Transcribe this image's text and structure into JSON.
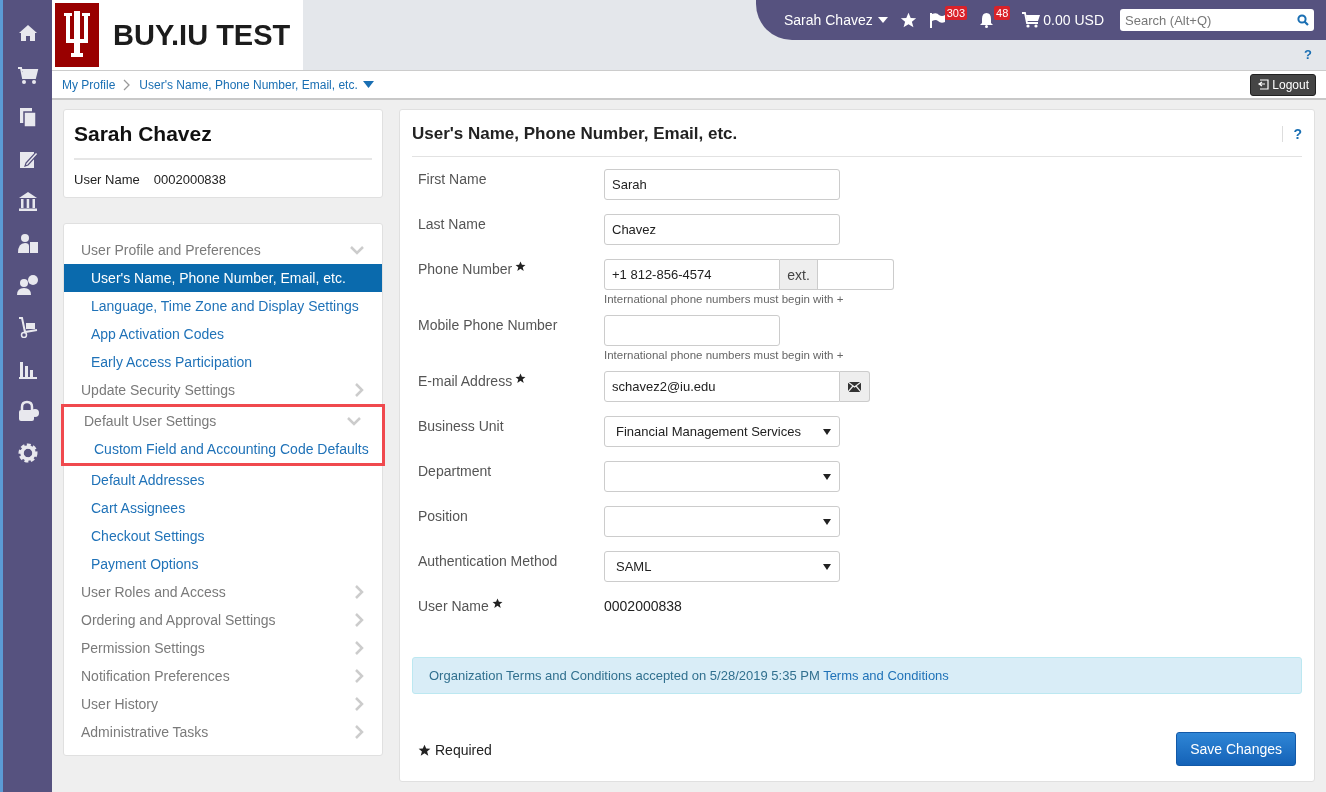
{
  "header": {
    "logo_text": "BUY.IU TEST",
    "user_menu": "Sarah Chavez",
    "flag_count": "303",
    "bell_count": "48",
    "cart_total": "0.00 USD",
    "search": {
      "placeholder": "Search (Alt+Q)"
    },
    "help": "?"
  },
  "breadcrumb": {
    "items": [
      {
        "label": "My Profile",
        "dropdown": false
      },
      {
        "label": "User's Name, Phone Number, Email, etc.",
        "dropdown": true
      }
    ],
    "logout": "Logout"
  },
  "profile": {
    "name": "Sarah Chavez",
    "user_name_label": "User Name",
    "user_name_value": "0002000838"
  },
  "nav": {
    "sections": [
      {
        "label": "User Profile and Preferences",
        "expanded": true,
        "highlighted": false,
        "children": [
          {
            "label": "User's Name, Phone Number, Email, etc.",
            "selected": true,
            "highlighted": false
          },
          {
            "label": "Language, Time Zone and Display Settings",
            "selected": false,
            "highlighted": false
          },
          {
            "label": "App Activation Codes",
            "selected": false,
            "highlighted": false
          },
          {
            "label": "Early Access Participation",
            "selected": false,
            "highlighted": false
          }
        ]
      },
      {
        "label": "Update Security Settings",
        "expanded": false,
        "highlighted": false
      },
      {
        "label": "Default User Settings",
        "expanded": true,
        "highlighted": true,
        "children": [
          {
            "label": "Custom Field and Accounting Code Defaults",
            "selected": false,
            "highlighted": true
          },
          {
            "label": "Default Addresses",
            "selected": false,
            "highlighted": false
          },
          {
            "label": "Cart Assignees",
            "selected": false,
            "highlighted": false
          },
          {
            "label": "Checkout Settings",
            "selected": false,
            "highlighted": false
          },
          {
            "label": "Payment Options",
            "selected": false,
            "highlighted": false
          }
        ]
      },
      {
        "label": "User Roles and Access",
        "expanded": false,
        "highlighted": false
      },
      {
        "label": "Ordering and Approval Settings",
        "expanded": false,
        "highlighted": false
      },
      {
        "label": "Permission Settings",
        "expanded": false,
        "highlighted": false
      },
      {
        "label": "Notification Preferences",
        "expanded": false,
        "highlighted": false
      },
      {
        "label": "User History",
        "expanded": false,
        "highlighted": false
      },
      {
        "label": "Administrative Tasks",
        "expanded": false,
        "highlighted": false
      }
    ]
  },
  "page": {
    "title": "User's Name, Phone Number, Email, etc.",
    "help": "?",
    "fields": [
      {
        "kind": "text",
        "label": "First Name",
        "required": false,
        "value": "Sarah"
      },
      {
        "kind": "text",
        "label": "Last Name",
        "required": false,
        "value": "Chavez"
      },
      {
        "kind": "phone",
        "label": "Phone Number",
        "required": true,
        "value": "+1 812-856-4574",
        "addon": "ext.",
        "hint": "International phone numbers must begin with +"
      },
      {
        "kind": "mobile",
        "label": "Mobile Phone Number",
        "required": false,
        "hint": "International phone numbers must begin with +"
      },
      {
        "kind": "email",
        "label": "E-mail Address",
        "required": true,
        "value": "schavez2@iu.edu"
      },
      {
        "kind": "select",
        "label": "Business Unit",
        "required": false,
        "value": "Financial Management Services"
      },
      {
        "kind": "select",
        "label": "Department",
        "required": false
      },
      {
        "kind": "select",
        "label": "Position",
        "required": false
      },
      {
        "kind": "select",
        "label": "Authentication Method",
        "required": false,
        "value": "SAML"
      },
      {
        "kind": "static",
        "label": "User Name",
        "required": true,
        "value": "0002000838"
      }
    ],
    "notice": {
      "text": "Organization Terms and Conditions accepted on 5/28/2019 5:35 PM",
      "link": "Terms and Conditions"
    },
    "required_note": "Required",
    "save": "Save Changes"
  }
}
